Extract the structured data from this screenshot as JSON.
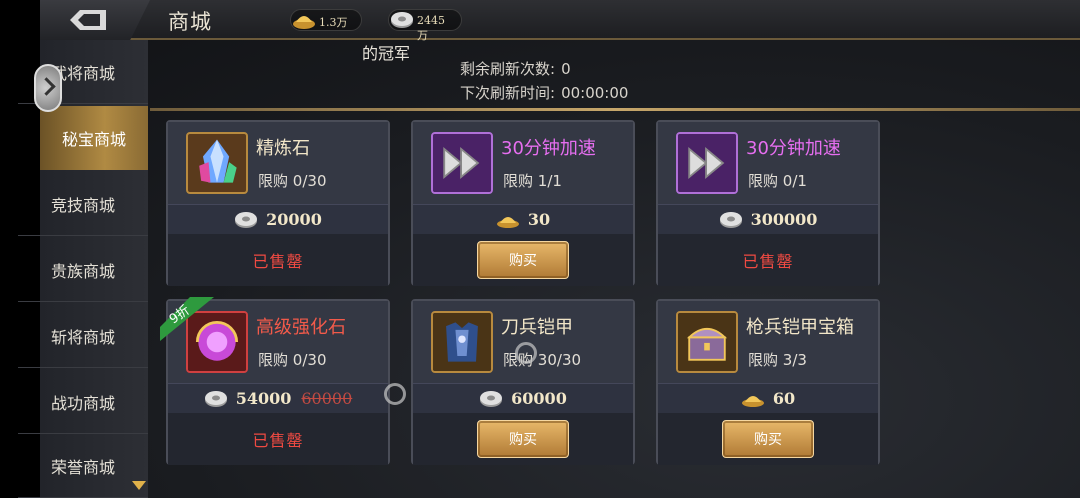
{
  "header": {
    "title": "商城",
    "gold": "1.3万",
    "silver": "2445万"
  },
  "sidebar": {
    "items": [
      {
        "label": "武将商城"
      },
      {
        "label": "秘宝商城"
      },
      {
        "label": "竞技商城"
      },
      {
        "label": "贵族商城"
      },
      {
        "label": "斩将商城"
      },
      {
        "label": "战功商城"
      },
      {
        "label": "荣誉商城"
      }
    ],
    "active": "秘宝商城"
  },
  "info": {
    "champion_text": "的冠军",
    "refresh_label": "剩余刷新次数:",
    "refresh_value": "0",
    "next_label": "下次刷新时间:",
    "next_value": "00:00:00"
  },
  "items": [
    {
      "name": "精炼石",
      "limit_label": "限购",
      "limit": "0/30",
      "currency": "silver",
      "price": "20000",
      "state": "已售罄",
      "icon": "crystal-icon"
    },
    {
      "name": "30分钟加速",
      "limit_label": "限购",
      "limit": "1/1",
      "currency": "gold",
      "price": "30",
      "state": "购买",
      "icon": "speedup-icon"
    },
    {
      "name": "30分钟加速",
      "limit_label": "限购",
      "limit": "0/1",
      "currency": "silver",
      "price": "300000",
      "state": "已售罄",
      "icon": "speedup-icon"
    },
    {
      "name": "高级强化石",
      "limit_label": "限购",
      "limit": "0/30",
      "currency": "silver",
      "price": "54000",
      "old_price": "60000",
      "badge": "9折",
      "state": "已售罄",
      "icon": "enhance-stone-icon"
    },
    {
      "name": "刀兵铠甲",
      "limit_label": "限购",
      "limit": "30/30",
      "currency": "silver",
      "price": "60000",
      "state": "购买",
      "icon": "armor-icon"
    },
    {
      "name": "枪兵铠甲宝箱",
      "limit_label": "限购",
      "limit": "3/3",
      "currency": "gold",
      "price": "60",
      "state": "购买",
      "icon": "treasure-chest-icon"
    }
  ],
  "colors": {
    "accent_gold": "#c7a76b",
    "sold_out_red": "#ef4a42",
    "purple_name": "#e66ef0"
  }
}
